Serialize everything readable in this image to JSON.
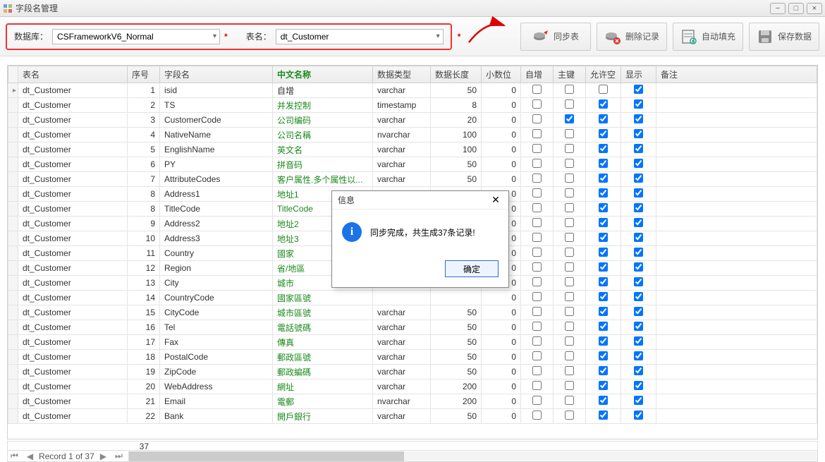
{
  "window": {
    "title": "字段名管理"
  },
  "filter": {
    "db_label": "数据库：",
    "db_value": "CSFrameworkV6_Normal",
    "table_label": "表名：",
    "table_value": "dt_Customer"
  },
  "toolbar": {
    "sync": "同步表",
    "delete": "删除记录",
    "autofill": "自动填充",
    "save": "保存数据"
  },
  "columns": {
    "table": "表名",
    "seq": "序号",
    "field": "字段名",
    "cname": "中文名称",
    "dtype": "数据类型",
    "dlen": "数据长度",
    "scale": "小数位",
    "auto": "自增",
    "pk": "主键",
    "nullable": "允许空",
    "show": "显示",
    "remark": "备注"
  },
  "rows": [
    {
      "t": "dt_Customer",
      "n": 1,
      "f": "isid",
      "c": "自增",
      "cgreen": false,
      "dt": "varchar",
      "dl": 50,
      "sc": 0,
      "ai": false,
      "pk": false,
      "nu": false,
      "sh": true
    },
    {
      "t": "dt_Customer",
      "n": 2,
      "f": "TS",
      "c": "并发控制",
      "cgreen": true,
      "dt": "timestamp",
      "dl": 8,
      "sc": 0,
      "ai": false,
      "pk": false,
      "nu": true,
      "sh": true
    },
    {
      "t": "dt_Customer",
      "n": 3,
      "f": "CustomerCode",
      "c": "公司编码",
      "cgreen": true,
      "dt": "varchar",
      "dl": 20,
      "sc": 0,
      "ai": false,
      "pk": true,
      "nu": true,
      "sh": true
    },
    {
      "t": "dt_Customer",
      "n": 4,
      "f": "NativeName",
      "c": "公司名稱",
      "cgreen": true,
      "dt": "nvarchar",
      "dl": 100,
      "sc": 0,
      "ai": false,
      "pk": false,
      "nu": true,
      "sh": true
    },
    {
      "t": "dt_Customer",
      "n": 5,
      "f": "EnglishName",
      "c": "英文名",
      "cgreen": true,
      "dt": "varchar",
      "dl": 100,
      "sc": 0,
      "ai": false,
      "pk": false,
      "nu": true,
      "sh": true
    },
    {
      "t": "dt_Customer",
      "n": 6,
      "f": "PY",
      "c": "拼音码",
      "cgreen": true,
      "dt": "varchar",
      "dl": 50,
      "sc": 0,
      "ai": false,
      "pk": false,
      "nu": true,
      "sh": true
    },
    {
      "t": "dt_Customer",
      "n": 7,
      "f": "AttributeCodes",
      "c": "客户属性.多个属性以...",
      "cgreen": true,
      "dt": "varchar",
      "dl": 50,
      "sc": 0,
      "ai": false,
      "pk": false,
      "nu": true,
      "sh": true
    },
    {
      "t": "dt_Customer",
      "n": 8,
      "f": "Address1",
      "c": "地址1",
      "cgreen": true,
      "dt": "",
      "dl": "",
      "sc": 0,
      "ai": false,
      "pk": false,
      "nu": true,
      "sh": true
    },
    {
      "t": "dt_Customer",
      "n": 8,
      "f": "TitleCode",
      "c": "TitleCode",
      "cgreen": true,
      "dt": "",
      "dl": "",
      "sc": 0,
      "ai": false,
      "pk": false,
      "nu": true,
      "sh": true
    },
    {
      "t": "dt_Customer",
      "n": 9,
      "f": "Address2",
      "c": "地址2",
      "cgreen": true,
      "dt": "",
      "dl": "",
      "sc": 0,
      "ai": false,
      "pk": false,
      "nu": true,
      "sh": true
    },
    {
      "t": "dt_Customer",
      "n": 10,
      "f": "Address3",
      "c": "地址3",
      "cgreen": true,
      "dt": "",
      "dl": "",
      "sc": 0,
      "ai": false,
      "pk": false,
      "nu": true,
      "sh": true
    },
    {
      "t": "dt_Customer",
      "n": 11,
      "f": "Country",
      "c": "國家",
      "cgreen": true,
      "dt": "",
      "dl": "",
      "sc": 0,
      "ai": false,
      "pk": false,
      "nu": true,
      "sh": true
    },
    {
      "t": "dt_Customer",
      "n": 12,
      "f": "Region",
      "c": "省/地區",
      "cgreen": true,
      "dt": "",
      "dl": "",
      "sc": 0,
      "ai": false,
      "pk": false,
      "nu": true,
      "sh": true
    },
    {
      "t": "dt_Customer",
      "n": 13,
      "f": "City",
      "c": "城市",
      "cgreen": true,
      "dt": "",
      "dl": "",
      "sc": 0,
      "ai": false,
      "pk": false,
      "nu": true,
      "sh": true
    },
    {
      "t": "dt_Customer",
      "n": 14,
      "f": "CountryCode",
      "c": "國家區號",
      "cgreen": true,
      "dt": "",
      "dl": "",
      "sc": 0,
      "ai": false,
      "pk": false,
      "nu": true,
      "sh": true
    },
    {
      "t": "dt_Customer",
      "n": 15,
      "f": "CityCode",
      "c": "城市區號",
      "cgreen": true,
      "dt": "varchar",
      "dl": 50,
      "sc": 0,
      "ai": false,
      "pk": false,
      "nu": true,
      "sh": true
    },
    {
      "t": "dt_Customer",
      "n": 16,
      "f": "Tel",
      "c": "電話號碼",
      "cgreen": true,
      "dt": "varchar",
      "dl": 50,
      "sc": 0,
      "ai": false,
      "pk": false,
      "nu": true,
      "sh": true
    },
    {
      "t": "dt_Customer",
      "n": 17,
      "f": "Fax",
      "c": "傳真",
      "cgreen": true,
      "dt": "varchar",
      "dl": 50,
      "sc": 0,
      "ai": false,
      "pk": false,
      "nu": true,
      "sh": true
    },
    {
      "t": "dt_Customer",
      "n": 18,
      "f": "PostalCode",
      "c": "郵政區號",
      "cgreen": true,
      "dt": "varchar",
      "dl": 50,
      "sc": 0,
      "ai": false,
      "pk": false,
      "nu": true,
      "sh": true
    },
    {
      "t": "dt_Customer",
      "n": 19,
      "f": "ZipCode",
      "c": "郵政編碼",
      "cgreen": true,
      "dt": "varchar",
      "dl": 50,
      "sc": 0,
      "ai": false,
      "pk": false,
      "nu": true,
      "sh": true
    },
    {
      "t": "dt_Customer",
      "n": 20,
      "f": "WebAddress",
      "c": "網址",
      "cgreen": true,
      "dt": "varchar",
      "dl": 200,
      "sc": 0,
      "ai": false,
      "pk": false,
      "nu": true,
      "sh": true
    },
    {
      "t": "dt_Customer",
      "n": 21,
      "f": "Email",
      "c": "電郵",
      "cgreen": true,
      "dt": "nvarchar",
      "dl": 200,
      "sc": 0,
      "ai": false,
      "pk": false,
      "nu": true,
      "sh": true
    },
    {
      "t": "dt_Customer",
      "n": 22,
      "f": "Bank",
      "c": "開戶銀行",
      "cgreen": true,
      "dt": "varchar",
      "dl": 50,
      "sc": 0,
      "ai": false,
      "pk": false,
      "nu": true,
      "sh": true
    }
  ],
  "summary": {
    "count": "37"
  },
  "navigator": {
    "text": "Record 1 of 37"
  },
  "dialog": {
    "title": "信息",
    "message": "同步完成，共生成37条记录!",
    "ok": "确定"
  }
}
